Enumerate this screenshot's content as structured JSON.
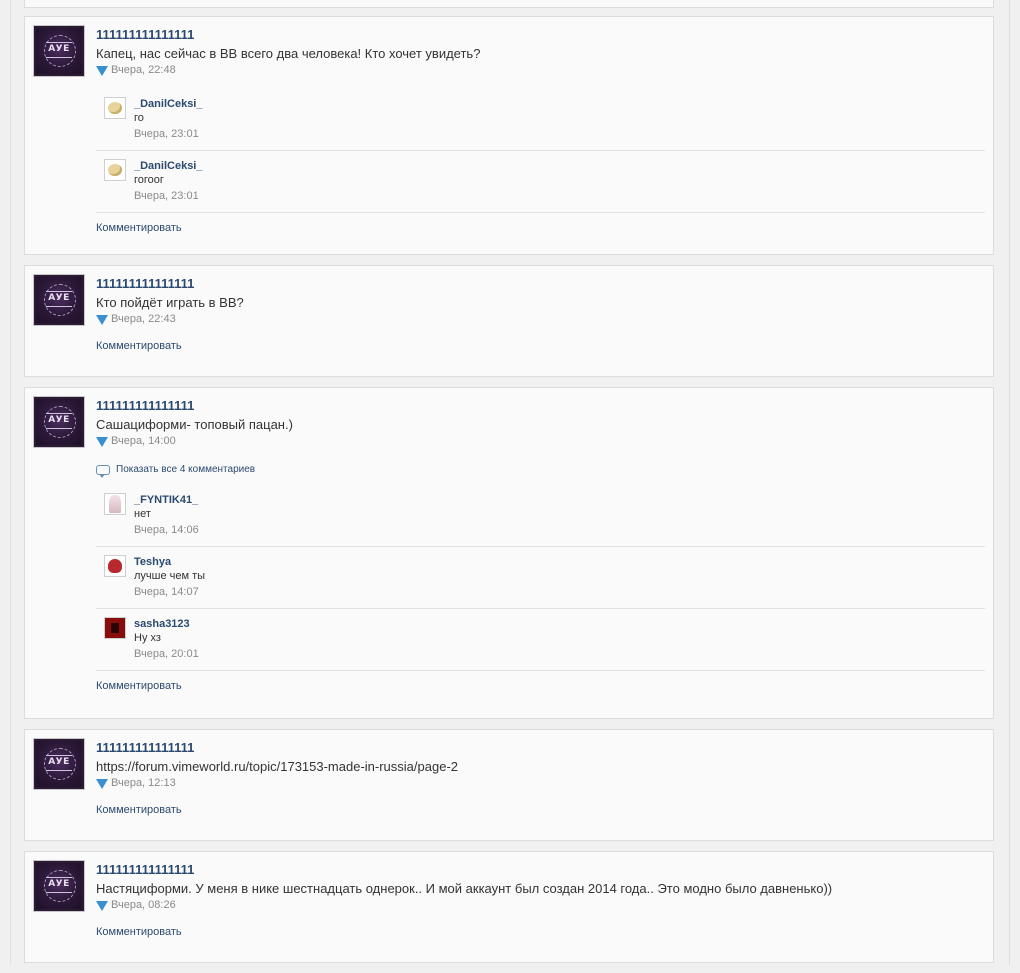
{
  "feed": {
    "comment_action_label": "Комментировать",
    "posts": [
      {
        "author": "111111111111111",
        "avatar_text": "АУЕ",
        "text": "Капец, нас сейчас в ВВ всего два человека! Кто хочет увидеть?",
        "time": "Вчера, 22:48",
        "show_all_label": "",
        "comments": [
          {
            "author": "_DanilCeksi_",
            "text": "го",
            "time": "Вчера, 23:01",
            "avatar": "potato"
          },
          {
            "author": "_DanilCeksi_",
            "text": "гогоог",
            "time": "Вчера, 23:01",
            "avatar": "potato"
          }
        ]
      },
      {
        "author": "111111111111111",
        "avatar_text": "АУЕ",
        "text": "Кто пойдёт играть в ВВ?",
        "time": "Вчера, 22:43",
        "comments": []
      },
      {
        "author": "111111111111111",
        "avatar_text": "АУЕ",
        "text": "Сашациформи- топовый пацан.)",
        "time": "Вчера, 14:00",
        "show_all_label": "Показать все 4 комментариев",
        "comments": [
          {
            "author": "_FYNTIK41_",
            "text": "нет",
            "time": "Вчера, 14:06",
            "avatar": "girl"
          },
          {
            "author": "Teshya",
            "text": "лучше чем ты",
            "time": "Вчера, 14:07",
            "avatar": "red"
          },
          {
            "author": "sasha3123",
            "text": "Ну хз",
            "time": "Вчера, 20:01",
            "avatar": "dark"
          }
        ]
      },
      {
        "author": "111111111111111",
        "avatar_text": "АУЕ",
        "text": "https://forum.vimeworld.ru/topic/173153-made-in-russia/page-2",
        "time": "Вчера, 12:13",
        "comments": []
      },
      {
        "author": "111111111111111",
        "avatar_text": "АУЕ",
        "text": "Настяциформи. У меня в нике шестнадцать однерок.. И мой аккаунт был создан 2014 года.. Это модно было давненько))",
        "time": "Вчера, 08:26",
        "comments": []
      }
    ]
  }
}
